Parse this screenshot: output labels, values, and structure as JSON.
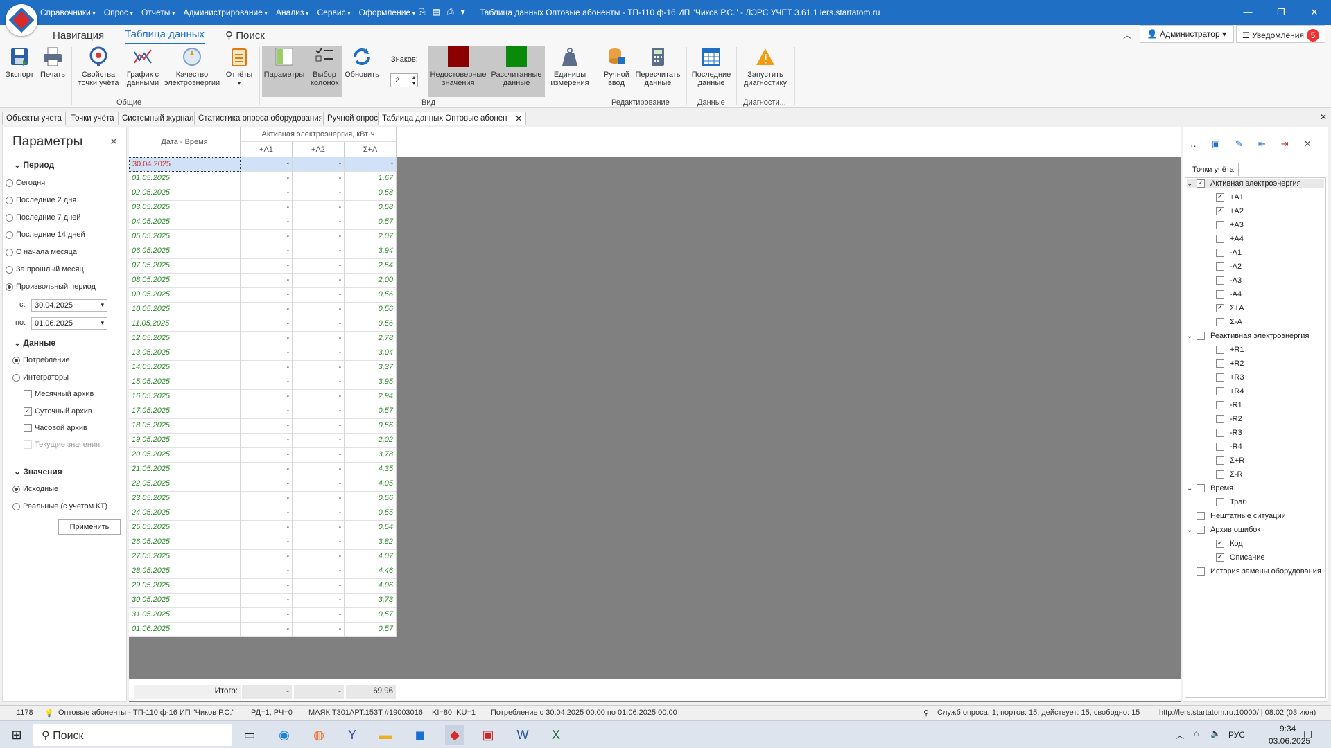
{
  "titlebar": {
    "menu": [
      "Справочники",
      "Опрос",
      "Отчеты",
      "Администрирование",
      "Анализ",
      "Сервис",
      "Оформление"
    ],
    "title": "Таблица данных Оптовые абоненты - ТП-110 ф-16  ИП \"Чиков Р.С.\" - ЛЭРС УЧЕТ 3.61.1 lers.startatom.ru",
    "minimize": "—",
    "restore": "❐",
    "close": "✕"
  },
  "ribbon_tabs": [
    "Навигация",
    "Таблица данных",
    "Поиск"
  ],
  "user": {
    "name": "Администратор",
    "notifications_label": "Уведомления",
    "notifications_count": "5"
  },
  "ribbon": {
    "buttons": [
      "Экспорт",
      "Печать",
      "Свойства точки учёта",
      "График с данными",
      "Качество электроэнергии",
      "Отчёты",
      "Параметры",
      "Выбор колонок",
      "Обновить",
      "Недостоверные значения",
      "Рассчитанные данные",
      "Единицы измерения",
      "Ручной ввод",
      "Пересчитать данные",
      "Последние данные",
      "Запустить диагностику"
    ],
    "digits_label": "Знаков:",
    "digits_value": "2",
    "groups": [
      "Общие",
      "Вид",
      "Редактирование",
      "Данные",
      "Диагности..."
    ],
    "colors": {
      "unreliable": "#8b0000",
      "calculated": "#0a8a0a",
      "accent": "#1f6fc5"
    }
  },
  "doc_tabs": [
    "Объекты учета",
    "Точки учёта",
    "Системный журнал",
    "Статистика опроса оборудования",
    "Ручной опрос",
    "Таблица данных Оптовые абоненты"
  ],
  "params": {
    "title": "Параметры",
    "period_title": "Период",
    "period_options": [
      "Сегодня",
      "Последние 2 дня",
      "Последние 7 дней",
      "Последние 14 дней",
      "С начала месяца",
      "За прошлый месяц",
      "Произвольный период"
    ],
    "from_label": "с:",
    "from_value": "30.04.2025",
    "to_label": "по:",
    "to_value": "01.06.2025",
    "data_title": "Данные",
    "data_options": [
      "Потребление",
      "Интеграторы"
    ],
    "archives": [
      "Месячный архив",
      "Суточный архив",
      "Часовой архив",
      "Текущие значения"
    ],
    "values_title": "Значения",
    "values_options": [
      "Исходные",
      "Реальные (с учетом КТ)"
    ],
    "apply": "Применить"
  },
  "grid": {
    "col_datetime": "Дата - Время",
    "group_header": "Активная электроэнергия, кВт·ч",
    "cols": [
      "+A1",
      "+A2",
      "Σ+A"
    ],
    "rows": [
      [
        "30.04.2025",
        "-",
        "-",
        "-"
      ],
      [
        "01.05.2025",
        "-",
        "-",
        "1,67"
      ],
      [
        "02.05.2025",
        "-",
        "-",
        "0,58"
      ],
      [
        "03.05.2025",
        "-",
        "-",
        "0,58"
      ],
      [
        "04.05.2025",
        "-",
        "-",
        "0,57"
      ],
      [
        "05.05.2025",
        "-",
        "-",
        "2,07"
      ],
      [
        "06.05.2025",
        "-",
        "-",
        "3,94"
      ],
      [
        "07.05.2025",
        "-",
        "-",
        "2,54"
      ],
      [
        "08.05.2025",
        "-",
        "-",
        "2,00"
      ],
      [
        "09.05.2025",
        "-",
        "-",
        "0,56"
      ],
      [
        "10.05.2025",
        "-",
        "-",
        "0,56"
      ],
      [
        "11.05.2025",
        "-",
        "-",
        "0,56"
      ],
      [
        "12.05.2025",
        "-",
        "-",
        "2,78"
      ],
      [
        "13.05.2025",
        "-",
        "-",
        "3,04"
      ],
      [
        "14.05.2025",
        "-",
        "-",
        "3,37"
      ],
      [
        "15.05.2025",
        "-",
        "-",
        "3,95"
      ],
      [
        "16.05.2025",
        "-",
        "-",
        "2,94"
      ],
      [
        "17.05.2025",
        "-",
        "-",
        "0,57"
      ],
      [
        "18.05.2025",
        "-",
        "-",
        "0,56"
      ],
      [
        "19.05.2025",
        "-",
        "-",
        "2,02"
      ],
      [
        "20.05.2025",
        "-",
        "-",
        "3,78"
      ],
      [
        "21.05.2025",
        "-",
        "-",
        "4,35"
      ],
      [
        "22.05.2025",
        "-",
        "-",
        "4,05"
      ],
      [
        "23.05.2025",
        "-",
        "-",
        "0,56"
      ],
      [
        "24.05.2025",
        "-",
        "-",
        "0,55"
      ],
      [
        "25.05.2025",
        "-",
        "-",
        "0,54"
      ],
      [
        "26.05.2025",
        "-",
        "-",
        "3,82"
      ],
      [
        "27.05.2025",
        "-",
        "-",
        "4,07"
      ],
      [
        "28.05.2025",
        "-",
        "-",
        "4,46"
      ],
      [
        "29.05.2025",
        "-",
        "-",
        "4,06"
      ],
      [
        "30.05.2025",
        "-",
        "-",
        "3,73"
      ],
      [
        "31.05.2025",
        "-",
        "-",
        "0,57"
      ],
      [
        "01.06.2025",
        "-",
        "-",
        "0,57"
      ]
    ],
    "total_label": "Итого:",
    "totals": [
      "-",
      "-",
      "69,96"
    ]
  },
  "right_panel": {
    "tab": "Точки учёта",
    "tree": [
      {
        "label": "Активная электроэнергия",
        "level": 0,
        "checked": true,
        "expand": true
      },
      {
        "label": "+A1",
        "level": 1,
        "checked": true
      },
      {
        "label": "+A2",
        "level": 1,
        "checked": true
      },
      {
        "label": "+A3",
        "level": 1,
        "checked": false
      },
      {
        "label": "+A4",
        "level": 1,
        "checked": false
      },
      {
        "label": "-A1",
        "level": 1,
        "checked": false
      },
      {
        "label": "-A2",
        "level": 1,
        "checked": false
      },
      {
        "label": "-A3",
        "level": 1,
        "checked": false
      },
      {
        "label": "-A4",
        "level": 1,
        "checked": false
      },
      {
        "label": "Σ+A",
        "level": 1,
        "checked": true
      },
      {
        "label": "Σ-A",
        "level": 1,
        "checked": false
      },
      {
        "label": "Реактивная электроэнергия",
        "level": 0,
        "checked": false,
        "expand": true
      },
      {
        "label": "+R1",
        "level": 1,
        "checked": false
      },
      {
        "label": "+R2",
        "level": 1,
        "checked": false
      },
      {
        "label": "+R3",
        "level": 1,
        "checked": false
      },
      {
        "label": "+R4",
        "level": 1,
        "checked": false
      },
      {
        "label": "-R1",
        "level": 1,
        "checked": false
      },
      {
        "label": "-R2",
        "level": 1,
        "checked": false
      },
      {
        "label": "-R3",
        "level": 1,
        "checked": false
      },
      {
        "label": "-R4",
        "level": 1,
        "checked": false
      },
      {
        "label": "Σ+R",
        "level": 1,
        "checked": false
      },
      {
        "label": "Σ-R",
        "level": 1,
        "checked": false
      },
      {
        "label": "Время",
        "level": 0,
        "checked": false,
        "expand": true
      },
      {
        "label": "Траб",
        "level": 1,
        "checked": false
      },
      {
        "label": "Нештатные ситуации",
        "level": 0,
        "checked": false
      },
      {
        "label": "Архив ошибок",
        "level": 0,
        "checked": false,
        "expand": true
      },
      {
        "label": "Код",
        "level": 1,
        "checked": true
      },
      {
        "label": "Описание",
        "level": 1,
        "checked": true
      },
      {
        "label": "История замены оборудования",
        "level": 0,
        "checked": false
      }
    ]
  },
  "status": {
    "id": "1178",
    "object": "Оптовые абоненты - ТП-110 ф-16  ИП \"Чиков Р.С.\"",
    "rd": "РД=1, РЧ=0",
    "device": "МАЯК Т301АРТ.153Т #19003016",
    "ki": "KI=80, KU=1",
    "consumption": "Потребление с 30.04.2025 00:00 по 01.06.2025 00:00",
    "service": "Служб опроса: 1; портов: 15, действует: 15, свободно: 15",
    "server": "http://lers.startatom.ru:10000/ | 08:02 (03 июн)"
  },
  "taskbar": {
    "search": "Поиск",
    "lang": "РУС",
    "time": "9:34",
    "date": "03.06.2025"
  }
}
